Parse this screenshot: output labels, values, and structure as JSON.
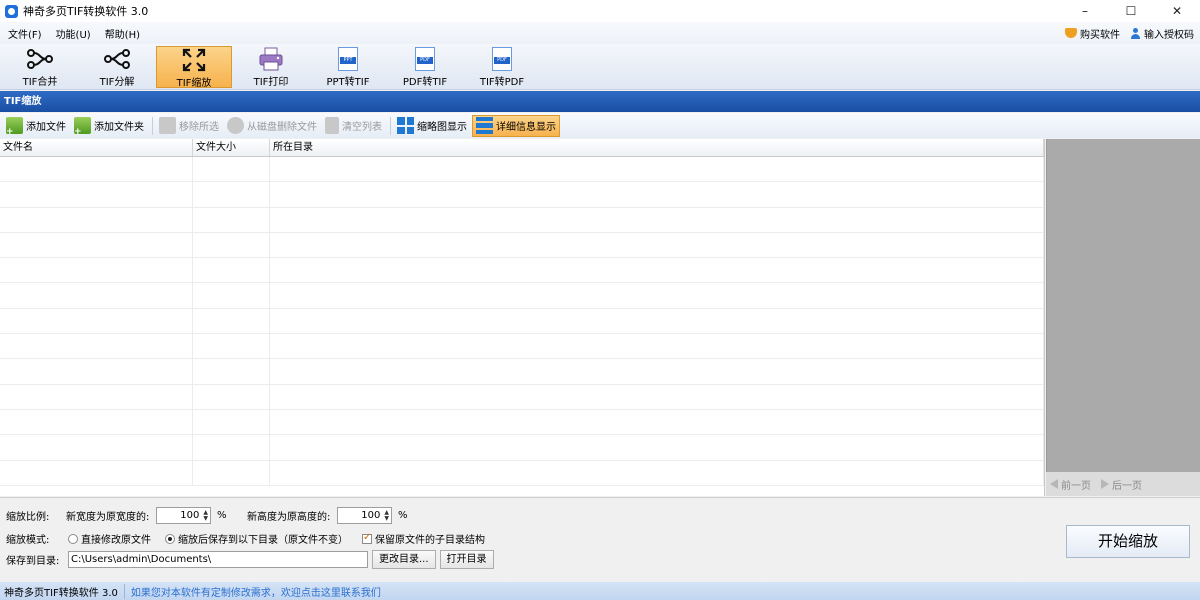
{
  "window": {
    "title": "神奇多页TIF转换软件 3.0",
    "controls": [
      "–",
      "☐",
      "✕"
    ]
  },
  "menu": {
    "items": [
      "文件(F)",
      "功能(U)",
      "帮助(H)"
    ],
    "buy": "购买软件",
    "license": "输入授权码"
  },
  "toolbar": {
    "buttons": [
      {
        "label": "TIF合并",
        "icon": "merge-icon",
        "active": false
      },
      {
        "label": "TIF分解",
        "icon": "split-icon",
        "active": false
      },
      {
        "label": "TIF缩放",
        "icon": "scale-icon",
        "active": true
      },
      {
        "label": "TIF打印",
        "icon": "printer-icon",
        "active": false
      },
      {
        "label": "PPT转TIF",
        "icon": "ppt-doc-icon",
        "badge": "PPT",
        "active": false
      },
      {
        "label": "PDF转TIF",
        "icon": "pdf-doc-icon",
        "badge": "PDF",
        "active": false
      },
      {
        "label": "TIF转PDF",
        "icon": "pdf-doc-icon",
        "badge": "PDF",
        "active": false
      }
    ]
  },
  "section": {
    "title": "TIF缩放"
  },
  "subtoolbar": {
    "add_file": "添加文件",
    "add_folder": "添加文件夹",
    "remove_selected": "移除所选",
    "delete_from_disk": "从磁盘删除文件",
    "clear_list": "清空列表",
    "thumbnail_view": "缩略图显示",
    "detail_view": "详细信息显示"
  },
  "filelist": {
    "columns": [
      "文件名",
      "文件大小",
      "所在目录"
    ],
    "rows": []
  },
  "preview": {
    "prev": "前一页",
    "next": "后一页"
  },
  "settings": {
    "scale_label": "缩放比例:",
    "width_label": "新宽度为原宽度的:",
    "width_value": "100",
    "height_label": "新高度为原高度的:",
    "height_value": "100",
    "percent": "%",
    "mode_label": "缩放模式:",
    "mode_direct": "直接修改原文件",
    "mode_save": "缩放后保存到以下目录（原文件不变）",
    "mode_selected": "save",
    "keep_structure": "保留原文件的子目录结构",
    "keep_structure_checked": true,
    "save_dir_label": "保存到目录:",
    "save_dir_value": "C:\\Users\\admin\\Documents\\",
    "change_dir": "更改目录...",
    "open_dir": "打开目录",
    "start": "开始缩放"
  },
  "status": {
    "app_name": "神奇多页TIF转换软件 3.0",
    "message": "如果您对本软件有定制修改需求，欢迎点击这里联系我们"
  }
}
